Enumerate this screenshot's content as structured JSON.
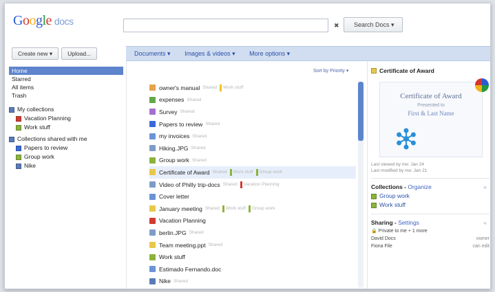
{
  "app": {
    "logo_letters": [
      "G",
      "o",
      "o",
      "g",
      "l",
      "e"
    ],
    "product": "docs"
  },
  "search": {
    "placeholder": "",
    "clear_glyph": "✖",
    "button_label": "Search Docs ▾"
  },
  "toolbar": {
    "create_label": "Create new ▾",
    "upload_label": "Upload..."
  },
  "menu": {
    "items": [
      "Documents ▾",
      "Images & videos ▾",
      "More options ▾"
    ]
  },
  "sidebar": {
    "nav": [
      "Home",
      "Starred",
      "All items",
      "Trash"
    ],
    "my_collections": {
      "label": "My collections",
      "items": [
        {
          "label": "Vacation Planning",
          "color": "#d23a30"
        },
        {
          "label": "Work stuff",
          "color": "#8bb33a"
        }
      ]
    },
    "shared_collections": {
      "label": "Collections shared with me",
      "items": [
        {
          "label": "Papers to review",
          "color": "#3a6ad8"
        },
        {
          "label": "Group work",
          "color": "#8bb33a"
        },
        {
          "label": "Nike",
          "color": "#5a7bb8"
        }
      ]
    }
  },
  "list": {
    "sort_label": "Sort by Priority ▾",
    "rows": [
      {
        "title": "owner's manual",
        "icon_color": "#e8a24a",
        "meta": "Shared",
        "tag_color": "#f0c419",
        "tag_label": "Work stuff"
      },
      {
        "title": "expenses",
        "icon_color": "#62a84a",
        "meta": "Shared",
        "tag_color": "",
        "tag_label": ""
      },
      {
        "title": "Survey",
        "icon_color": "#a46fd0",
        "meta": "Shared",
        "tag_color": "",
        "tag_label": ""
      },
      {
        "title": "Papers to review",
        "icon_color": "#3a6ad8",
        "meta": "Shared",
        "tag_color": "",
        "tag_label": ""
      },
      {
        "title": "my invoices",
        "icon_color": "#6b93d6",
        "meta": "Shared",
        "tag_color": "",
        "tag_label": ""
      },
      {
        "title": "Hiking.JPG",
        "icon_color": "#7f9cc8",
        "meta": "Shared",
        "tag_color": "",
        "tag_label": ""
      },
      {
        "title": "Group work",
        "icon_color": "#8bb33a",
        "meta": "Shared",
        "tag_color": "",
        "tag_label": ""
      },
      {
        "title": "Certificate of Award",
        "icon_color": "#e8c84a",
        "meta": "Shared",
        "tag_color": "#8bb33a",
        "tag_label": "Work stuff",
        "selected": true,
        "tag2_color": "#8bb33a",
        "tag2_label": "Group work"
      },
      {
        "title": "Video of Philly trip-docs",
        "icon_color": "#7f9cc8",
        "meta": "Shared",
        "tag_color": "#d23a30",
        "tag_label": "Vacation Planning"
      },
      {
        "title": "Cover letter",
        "icon_color": "#6b93d6",
        "meta": "",
        "tag_color": "",
        "tag_label": ""
      },
      {
        "title": "January meeting",
        "icon_color": "#e8c84a",
        "meta": "Shared",
        "tag_color": "#8bb33a",
        "tag_label": "Work stuff",
        "tag2_color": "#8bb33a",
        "tag2_label": "Group work"
      },
      {
        "title": "Vacation Planning",
        "icon_color": "#d23a30",
        "meta": "",
        "tag_color": "",
        "tag_label": ""
      },
      {
        "title": "berlin.JPG",
        "icon_color": "#7f9cc8",
        "meta": "Shared",
        "tag_color": "",
        "tag_label": ""
      },
      {
        "title": "Team meeting.ppt",
        "icon_color": "#e8c84a",
        "meta": "Shared",
        "tag_color": "",
        "tag_label": ""
      },
      {
        "title": "Work stuff",
        "icon_color": "#8bb33a",
        "meta": "",
        "tag_color": "",
        "tag_label": ""
      },
      {
        "title": "Estimado Fernando.doc",
        "icon_color": "#6b93d6",
        "meta": "",
        "tag_color": "",
        "tag_label": ""
      },
      {
        "title": "Nike",
        "icon_color": "#5a7bb8",
        "meta": "Shared",
        "tag_color": "",
        "tag_label": ""
      }
    ]
  },
  "panel": {
    "title": "Certificate of Award",
    "preview": {
      "title": "Certificate of Award",
      "sub": "Presented to",
      "name": "First & Last Name"
    },
    "viewed": "Last viewed by me: Jan 24",
    "modified": "Last modified by me: Jan 21",
    "collections_title": "Collections",
    "organize_label": "Organize",
    "collections": [
      {
        "label": "Group work",
        "color": "#8bb33a"
      },
      {
        "label": "Work stuff",
        "color": "#8bb33a"
      }
    ],
    "sharing_title": "Sharing",
    "settings_label": "Settings",
    "privacy": "Private to me + 1 more",
    "people": [
      {
        "name": "David Docs",
        "role": "owner"
      },
      {
        "name": "Fiona File",
        "role": "can edit"
      }
    ],
    "collapse_glyph": "«"
  }
}
